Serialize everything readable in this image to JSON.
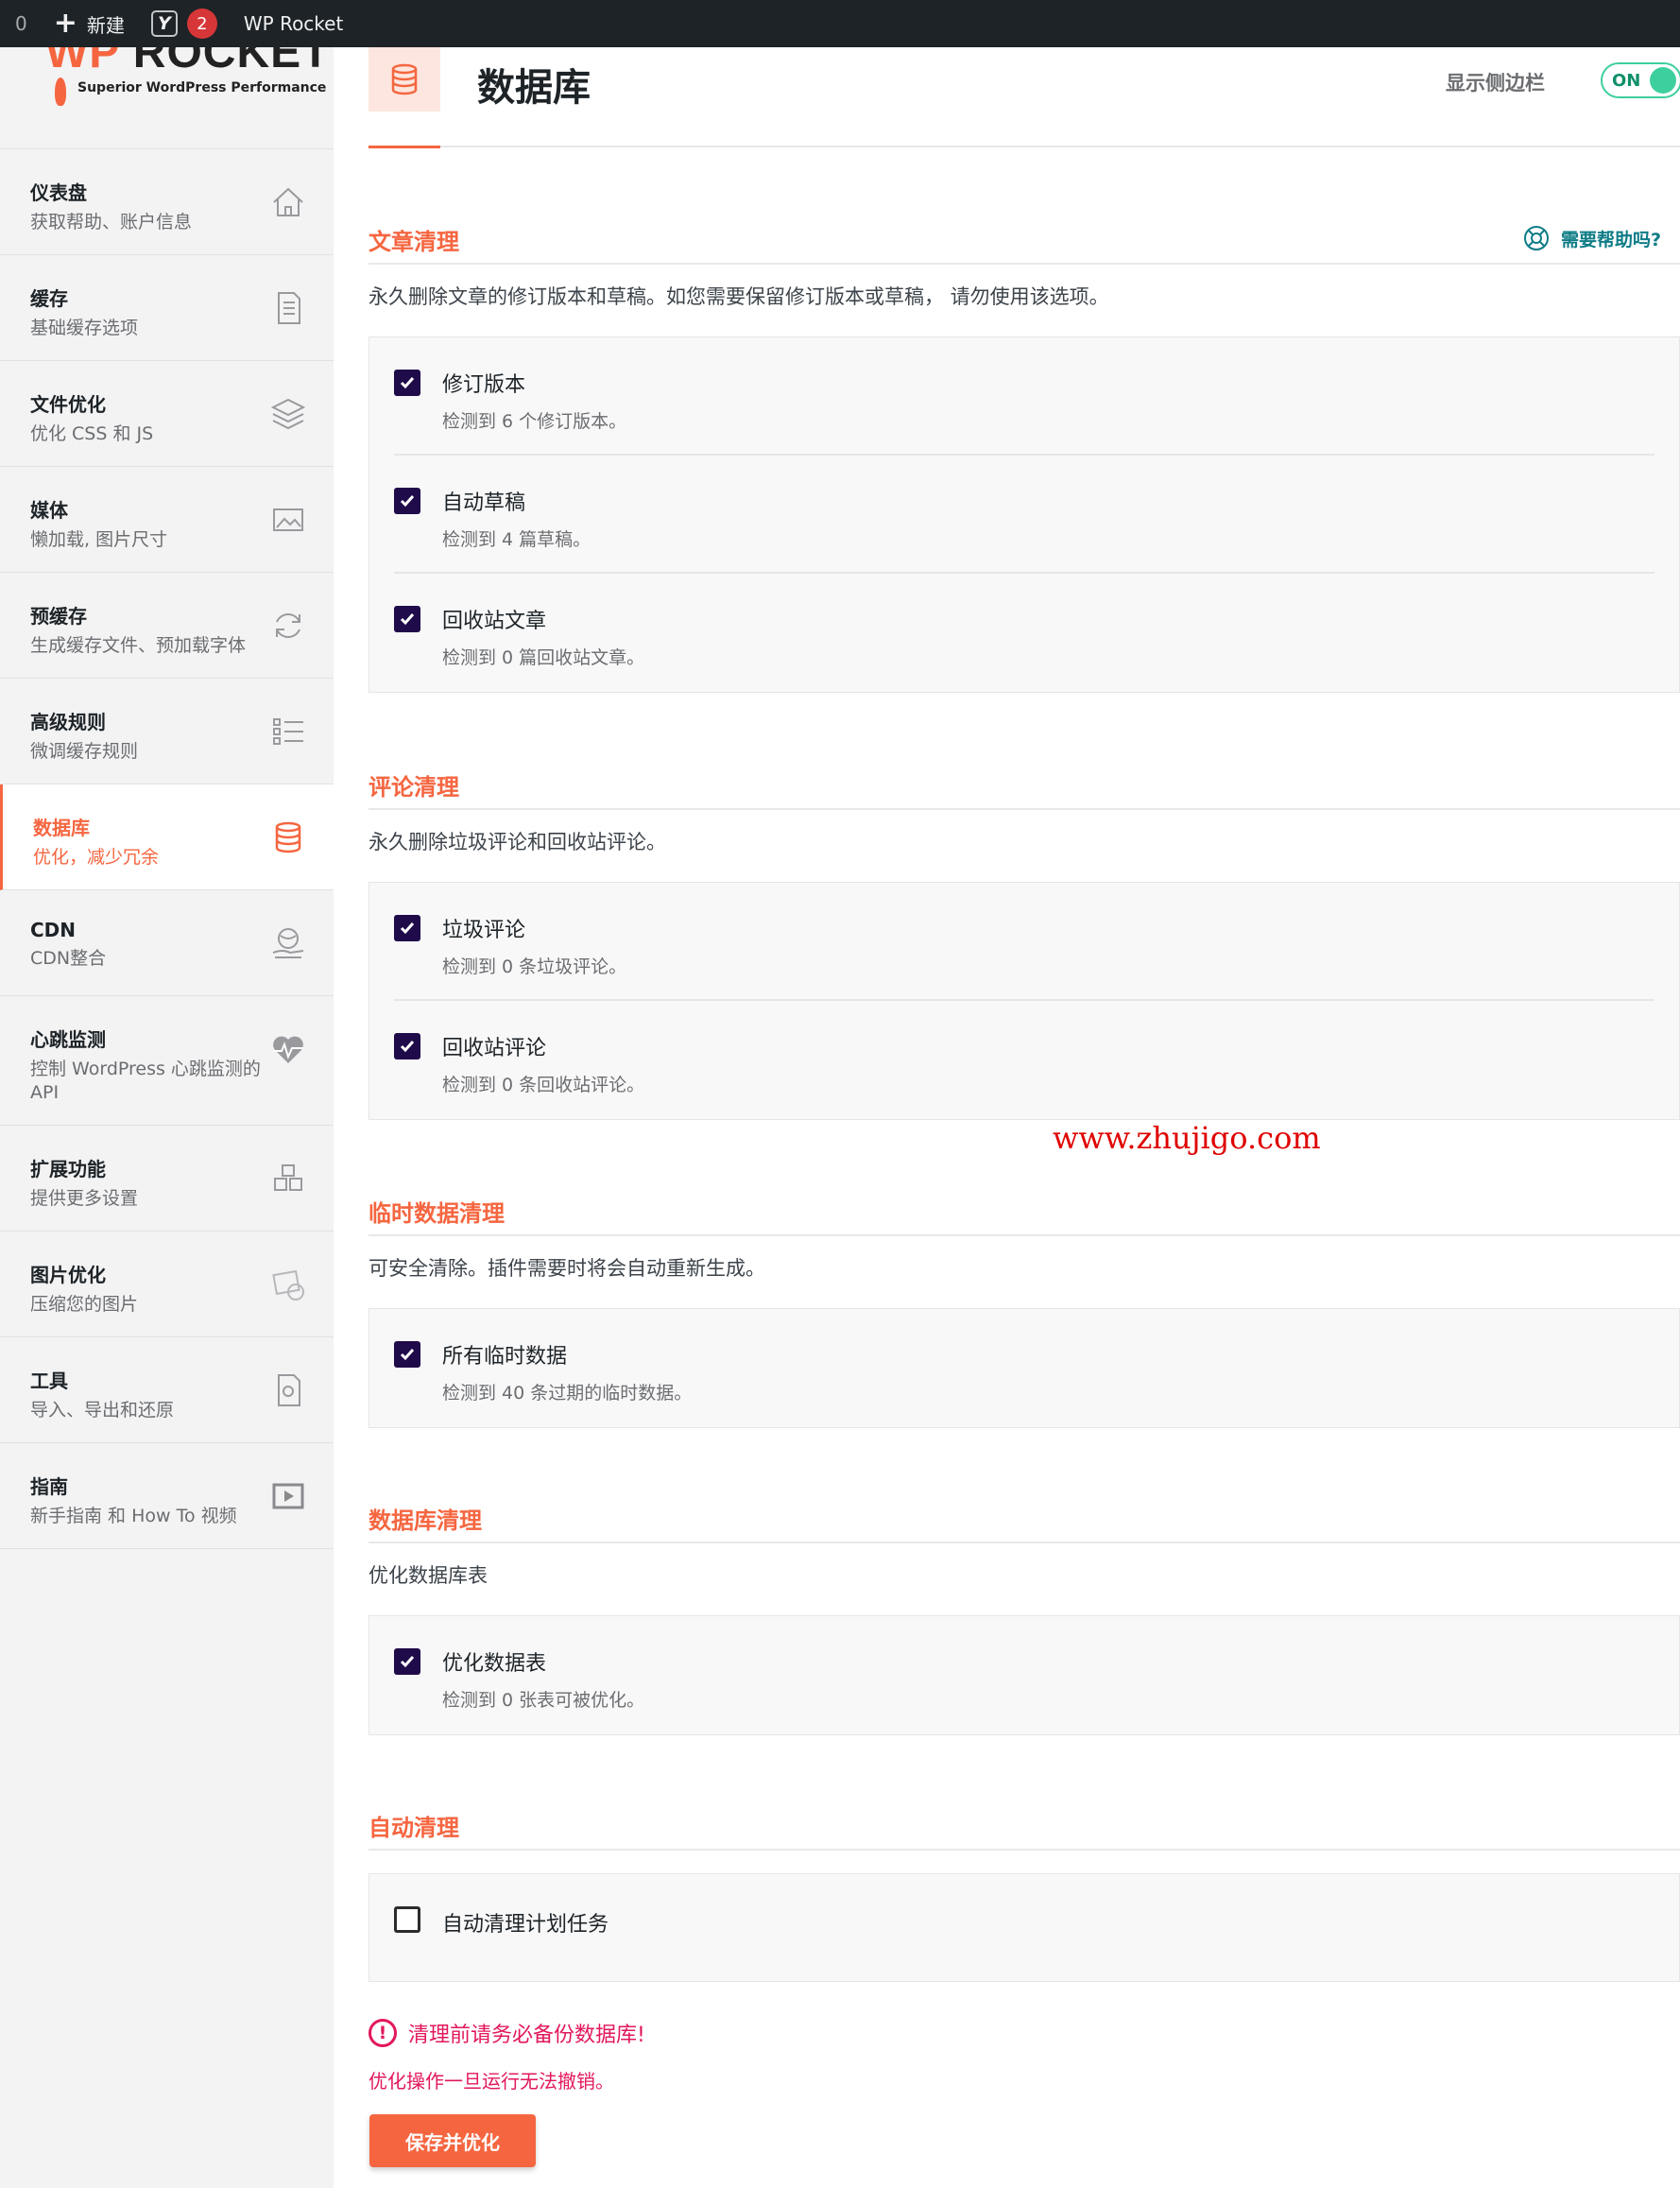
{
  "admin_bar": {
    "counter": "0",
    "new_label": "新建",
    "yoast_letter": "Y",
    "notification_count": "2",
    "plugin_label": "WP Rocket"
  },
  "logo": {
    "brand_wp": "WP",
    "brand_rocket": "ROCKET",
    "tagline": "Superior WordPress Performance"
  },
  "sidebar": {
    "items": [
      {
        "title": "仪表盘",
        "subtitle": "获取帮助、账户信息",
        "icon": "home-icon"
      },
      {
        "title": "缓存",
        "subtitle": "基础缓存选项",
        "icon": "document-icon"
      },
      {
        "title": "文件优化",
        "subtitle": "优化 CSS 和 JS",
        "icon": "layers-icon"
      },
      {
        "title": "媒体",
        "subtitle": "懒加载, 图片尺寸",
        "icon": "image-icon"
      },
      {
        "title": "预缓存",
        "subtitle": "生成缓存文件、预加载字体",
        "icon": "refresh-icon"
      },
      {
        "title": "高级规则",
        "subtitle": "微调缓存规则",
        "icon": "list-icon"
      },
      {
        "title": "数据库",
        "subtitle": "优化，减少冗余",
        "icon": "database-icon"
      },
      {
        "title": "CDN",
        "subtitle": "CDN整合",
        "icon": "globe-hand-icon"
      },
      {
        "title": "心跳监测",
        "subtitle": "控制 WordPress 心跳监测的 API",
        "icon": "heartbeat-icon"
      },
      {
        "title": "扩展功能",
        "subtitle": "提供更多设置",
        "icon": "cubes-icon"
      },
      {
        "title": "图片优化",
        "subtitle": "压缩您的图片",
        "icon": "image-optimize-icon"
      },
      {
        "title": "工具",
        "subtitle": "导入、导出和还原",
        "icon": "tools-icon"
      },
      {
        "title": "指南",
        "subtitle": "新手指南 和 How To 视频",
        "icon": "video-icon"
      }
    ]
  },
  "header": {
    "title": "数据库",
    "sidebar_toggle_label": "显示侧边栏",
    "toggle_state": "ON"
  },
  "sections": {
    "posts": {
      "title": "文章清理",
      "help": "需要帮助吗?",
      "desc": "永久删除文章的修订版本和草稿。如您需要保留修订版本或草稿， 请勿使用该选项。",
      "options": [
        {
          "label": "修订版本",
          "detail": "检测到 6 个修订版本。",
          "checked": true
        },
        {
          "label": "自动草稿",
          "detail": "检测到 4 篇草稿。",
          "checked": true
        },
        {
          "label": "回收站文章",
          "detail": "检测到 0 篇回收站文章。",
          "checked": true
        }
      ]
    },
    "comments": {
      "title": "评论清理",
      "desc": "永久删除垃圾评论和回收站评论。",
      "options": [
        {
          "label": "垃圾评论",
          "detail": "检测到 0 条垃圾评论。",
          "checked": true
        },
        {
          "label": "回收站评论",
          "detail": "检测到 0 条回收站评论。",
          "checked": true
        }
      ]
    },
    "transients": {
      "title": "临时数据清理",
      "desc": "可安全清除。插件需要时将会自动重新生成。",
      "options": [
        {
          "label": "所有临时数据",
          "detail": "检测到 40 条过期的临时数据。",
          "checked": true
        }
      ]
    },
    "database": {
      "title": "数据库清理",
      "desc": "优化数据库表",
      "options": [
        {
          "label": "优化数据表",
          "detail": "检测到 0 张表可被优化。",
          "checked": true
        }
      ]
    },
    "auto": {
      "title": "自动清理",
      "options": [
        {
          "label": "自动清理计划任务",
          "checked": false
        }
      ]
    }
  },
  "warning": {
    "mark": "!",
    "title": "清理前请务必备份数据库!",
    "subtitle": "优化操作一旦运行无法撤销。"
  },
  "save_button": "保存并优化",
  "watermark": "www.zhujigo.com",
  "colors": {
    "accent": "#f56640",
    "checkbox": "#1f0b4a",
    "toggle": "#3ecf9e",
    "warning": "#e2185b",
    "help": "#0e7c86"
  }
}
